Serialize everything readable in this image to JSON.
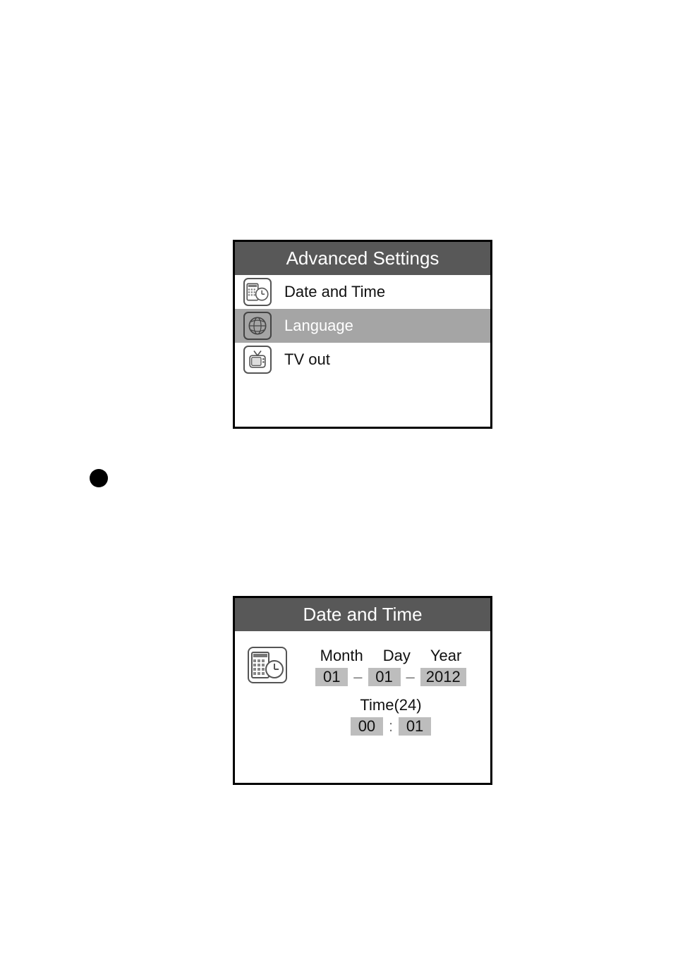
{
  "advanced_settings": {
    "title": "Advanced Settings",
    "items": [
      {
        "label": "Date and Time",
        "icon": "calendar-clock",
        "selected": false
      },
      {
        "label": "Language",
        "icon": "globe",
        "selected": true
      },
      {
        "label": "TV out",
        "icon": "tv",
        "selected": false
      }
    ]
  },
  "date_time": {
    "title": "Date and Time",
    "columns": [
      "Month",
      "Day",
      "Year"
    ],
    "month": "01",
    "day": "01",
    "year": "2012",
    "time_label": "Time(24)",
    "hour": "00",
    "minute": "01"
  }
}
